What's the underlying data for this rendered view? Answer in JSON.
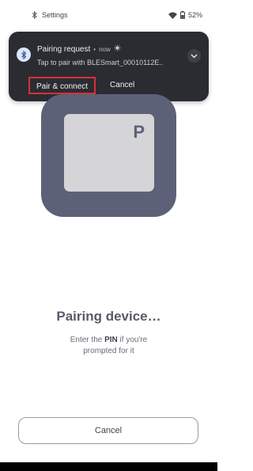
{
  "status_bar": {
    "app_label": "Settings",
    "battery": "52%"
  },
  "notification": {
    "title": "Pairing request",
    "separator": "•",
    "time": "now",
    "body": "Tap to pair with BLESmart_00010112E..",
    "actions": {
      "pair": "Pair & connect",
      "cancel": "Cancel"
    },
    "highlight_color": "#d5313a"
  },
  "illustration": {
    "key_letter": "P",
    "card_color": "#5d6178",
    "key_color": "#d5d5d8"
  },
  "main": {
    "title": "Pairing device…",
    "subtitle_prefix": "Enter the ",
    "subtitle_bold": "PIN",
    "subtitle_suffix": " if you're prompted for it",
    "cancel_label": "Cancel"
  }
}
